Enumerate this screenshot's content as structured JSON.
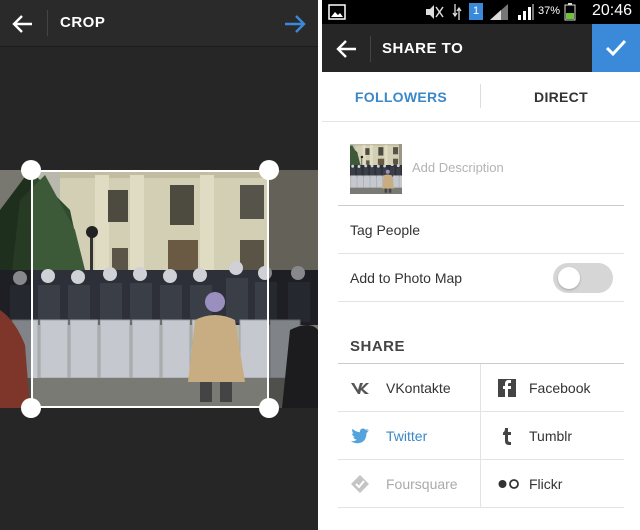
{
  "crop_screen": {
    "title": "CROP"
  },
  "status_bar": {
    "battery_percent": "37%",
    "time": "20:46",
    "notification_badge": "1"
  },
  "share_screen": {
    "title": "SHARE TO",
    "tabs": [
      {
        "label": "FOLLOWERS",
        "active": true
      },
      {
        "label": "DIRECT",
        "active": false
      }
    ],
    "description_placeholder": "Add Description",
    "tag_people_label": "Tag People",
    "photo_map_label": "Add to Photo Map",
    "photo_map_enabled": false,
    "share_heading": "SHARE",
    "share_targets": [
      {
        "label": "VKontakte",
        "icon": "vk-icon",
        "state": "normal"
      },
      {
        "label": "Facebook",
        "icon": "facebook-icon",
        "state": "normal"
      },
      {
        "label": "Twitter",
        "icon": "twitter-icon",
        "state": "active"
      },
      {
        "label": "Tumblr",
        "icon": "tumblr-icon",
        "state": "normal"
      },
      {
        "label": "Foursquare",
        "icon": "foursquare-icon",
        "state": "disabled"
      },
      {
        "label": "Flickr",
        "icon": "flickr-icon",
        "state": "normal"
      }
    ]
  },
  "colors": {
    "accent_blue": "#3b88c8",
    "confirm_blue": "#3b8ad9",
    "toolbar_dark": "#262626"
  }
}
